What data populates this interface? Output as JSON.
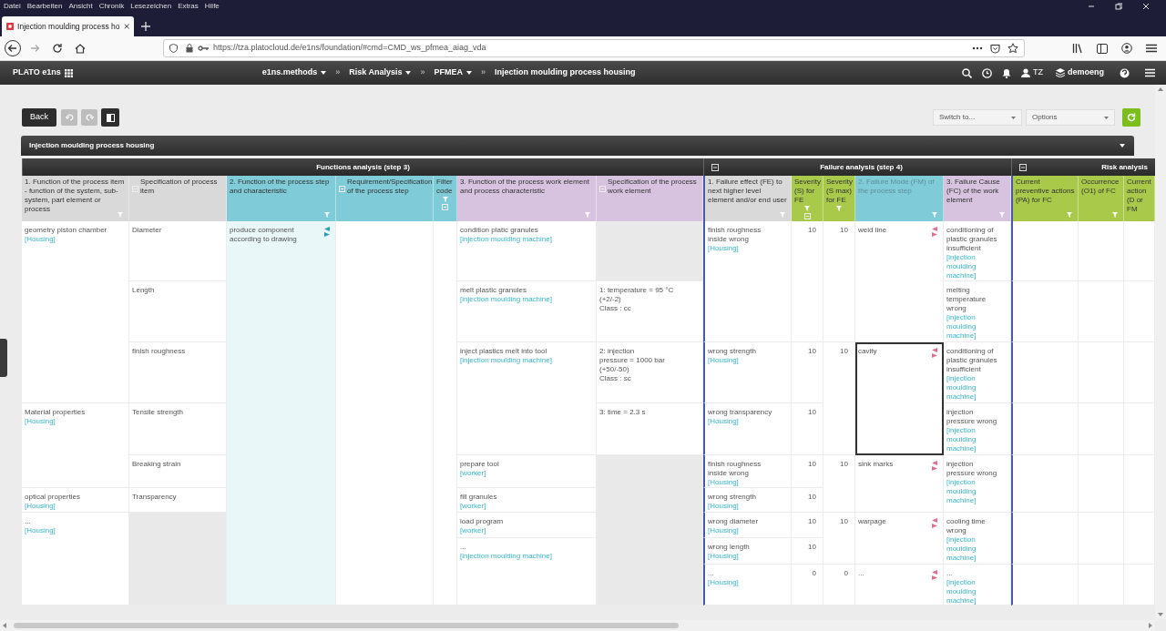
{
  "browser": {
    "menu": [
      "Datei",
      "Bearbeiten",
      "Ansicht",
      "Chronik",
      "Lesezeichen",
      "Extras",
      "Hilfe"
    ],
    "tab": {
      "title": "Injection moulding process ho"
    },
    "url": "https://tza.platocloud.de/e1ns/foundation/#cmd=CMD_ws_pfmea_aiag_vda"
  },
  "app": {
    "brand": "PLATO e1ns",
    "breadcrumb": [
      {
        "label": "e1ns.methods",
        "dropdown": true
      },
      {
        "separator": "»",
        "label": "Risk Analysis",
        "dropdown": true
      },
      {
        "separator": "»",
        "label": "PFMEA",
        "dropdown": true
      },
      {
        "separator": "»",
        "label": "Injection moulding process housing",
        "dropdown": false
      }
    ],
    "user": "TZ",
    "workspace": "demoeng"
  },
  "toolbar": {
    "back": "Back",
    "switch_to": "Switch to...",
    "options": "Options"
  },
  "panel": {
    "title": "Injection moulding process housing"
  },
  "groups": [
    {
      "title": "Functions analysis (step 3)",
      "collapsible": false,
      "columns": [
        {
          "header": "1. Function of the process item - function of the system, sub-system, part element or process",
          "color": "#d9d9d9",
          "filter": true,
          "expand": false,
          "kind": "text",
          "cells": [
            {
              "text": "geometry piston chamber",
              "ref": "[Housing]"
            },
            {
              "text": "Material properties",
              "ref": "[Housing]"
            },
            {
              "text": "optical properties",
              "ref": "[Housing]"
            },
            {
              "text": "...",
              "ref": "[Housing]"
            }
          ]
        },
        {
          "header": "Specification of process item",
          "color": "#d9d9d9",
          "filter": false,
          "expand": true,
          "kind": "text",
          "cells": [
            {
              "text": "Diameter"
            },
            {
              "text": "Length"
            },
            {
              "text": "finish roughness"
            },
            {
              "text": "Tensile strength"
            },
            {
              "text": "Breaking strain"
            },
            {
              "text": "Transparency"
            },
            {
              "shaded": true
            }
          ]
        },
        {
          "header": "2. Function of the process step and characteristic",
          "color": "#7fcbd8",
          "filter": true,
          "expand": false,
          "kind": "text",
          "cells": [
            {
              "text": "produce component according to drawing",
              "arrows": true,
              "tinted": true
            }
          ]
        },
        {
          "header": "Requirement/Specification of the process step",
          "color": "#7fcbd8",
          "filter": false,
          "expand": true,
          "kind": "text"
        },
        {
          "header": "Filter code",
          "color": "#7fcbd8",
          "filter": true,
          "expand": true,
          "kind": "text"
        },
        {
          "header": "3. Function of the process work element and process characteristic",
          "color": "#d7c3df",
          "filter": true,
          "expand": false,
          "kind": "text",
          "cells": [
            {
              "text": "condition platic granules",
              "ref": "[injection moulding machine]"
            },
            {
              "text": "melt plastic granules",
              "ref": "[injection moulding machine]"
            },
            {
              "text": "inject plastics melt into tool",
              "ref": "[injection moulding machine]"
            },
            {
              "text": "prepare tool",
              "ref": "[worker]"
            },
            {
              "text": "fill granules",
              "ref": "[worker]"
            },
            {
              "text": "load program",
              "ref": "[worker]"
            },
            {
              "text": "...",
              "ref": "[injection moulding machine]"
            }
          ]
        },
        {
          "header": "Specification of the process work element",
          "color": "#d7c3df",
          "filter": false,
          "expand": true,
          "kind": "text",
          "cells": [
            {
              "shaded": true
            },
            {
              "text": "1: temperature = 95 °C (+2/-2)\nClass : cc"
            },
            {
              "text": "2: injection\npressure = 1000 bar (+50/-50)\nClass : sc"
            },
            {
              "text": "3: time = 2.3 s"
            },
            {
              "shaded": true
            }
          ]
        }
      ]
    },
    {
      "title": "Failure analysis (step 4)",
      "collapsible": true,
      "columns": [
        {
          "header": "1. Failure effect (FE) to next higher level element and/or end user",
          "color": "#d9d9d9",
          "filter": true,
          "expand": false,
          "kind": "text",
          "cells": [
            {
              "text": "finish roughness inside wrong",
              "ref": "[Housing]"
            },
            {
              "text": "wrong strength",
              "ref": "[Housing]"
            },
            {
              "text": "wrong transparency",
              "ref": "[Housing]"
            },
            {
              "text": "finish roughness inside wrong",
              "ref": "[Housing]"
            },
            {
              "text": "wrong strength",
              "ref": "[Housing]"
            },
            {
              "text": "wrong diameter",
              "ref": "[Housing]"
            },
            {
              "text": "wrong length",
              "ref": "[Housing]"
            },
            {
              "text": "...",
              "ref": "[Housing]"
            }
          ]
        },
        {
          "header": "Severity (S) for FE",
          "color": "#a9c94a",
          "filter": true,
          "expand": true,
          "kind": "number",
          "cells": [
            {
              "text": "10"
            },
            {
              "text": "10"
            },
            {
              "text": "10"
            },
            {
              "text": "10"
            },
            {
              "text": "10"
            },
            {
              "text": "10"
            },
            {
              "text": "10"
            },
            {
              "text": "0"
            }
          ]
        },
        {
          "header": "Severity (S max) for FE",
          "color": "#a9c94a",
          "filter": true,
          "expand": false,
          "kind": "number",
          "cells": [
            {
              "text": "10"
            },
            {
              "text": "10"
            },
            {
              "text": "10"
            },
            {
              "text": "10"
            },
            {
              "text": "0"
            }
          ]
        },
        {
          "header": "2. Failure Mode (FM) of the process step",
          "color": "#7fcbd8",
          "filter": true,
          "expand": false,
          "muted": true,
          "kind": "text",
          "cells": [
            {
              "text": "weld line",
              "arrows": true,
              "selected": false
            },
            {
              "text": "cavity",
              "arrows": true,
              "selected": true
            },
            {
              "text": "sink marks",
              "arrows": true,
              "selected": false
            },
            {
              "text": "warpage",
              "arrows": true,
              "selected": false
            },
            {
              "text": "...",
              "arrows": true,
              "selected": false
            }
          ]
        },
        {
          "header": "3. Failure Cause (FC) of the work element",
          "color": "#d7c3df",
          "filter": true,
          "expand": false,
          "kind": "text",
          "cells": [
            {
              "text": "conditioning of plastic granules insufficient",
              "ref": "[injection moulding machine]"
            },
            {
              "text": "melting temperature wrong",
              "ref": "[injection moulding machine]"
            },
            {
              "text": "conditioning of plastic granules insufficient",
              "ref": "[injection moulding machine]"
            },
            {
              "text": "injection pressure wrong",
              "ref": "[injection moulding machine]"
            },
            {
              "text": "injection pressure wrong",
              "ref": "[injection moulding machine]"
            },
            {
              "text": "cooling time wrong",
              "ref": "[injection moulding machine]"
            },
            {
              "text": "...",
              "ref": "[injection moulding machine]"
            }
          ]
        }
      ]
    },
    {
      "title": "Risk analysis",
      "collapsible": true,
      "columns": [
        {
          "header": "Current preventive actions (PA) for FC",
          "color": "#a9c94a",
          "filter": true,
          "expand": false,
          "kind": "text"
        },
        {
          "header": "Occurrence (O1) of FC",
          "color": "#a9c94a",
          "filter": true,
          "expand": false,
          "kind": "text"
        },
        {
          "header": "Current action (D or FM",
          "color": "#a9c94a",
          "filter": false,
          "expand": false,
          "kind": "text"
        }
      ]
    }
  ]
}
